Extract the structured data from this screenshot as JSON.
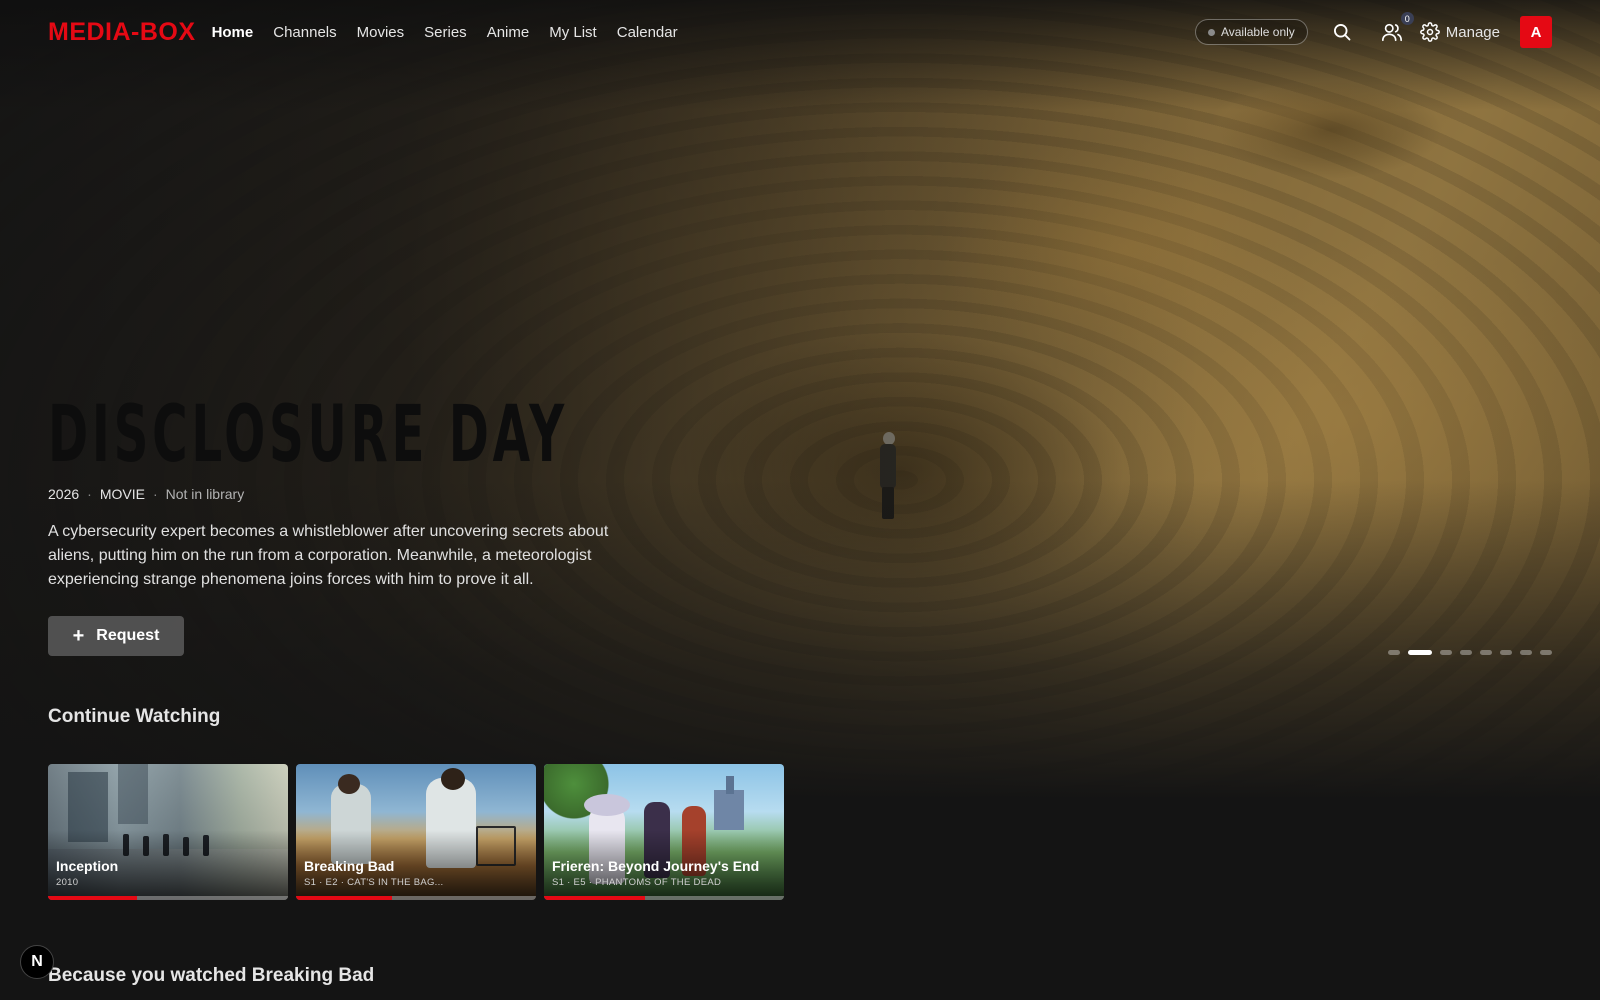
{
  "header": {
    "logo": "MEDIA-BOX",
    "nav": [
      "Home",
      "Channels",
      "Movies",
      "Series",
      "Anime",
      "My List",
      "Calendar"
    ],
    "active_nav": "Home",
    "availability_filter": "Available only",
    "requests_badge": "0",
    "manage_label": "Manage",
    "avatar_initial": "A",
    "accent_color": "#e50914"
  },
  "hero": {
    "title": "DISCLOSURE DAY",
    "year": "2026",
    "type": "MOVIE",
    "library_status": "Not in library",
    "description": "A cybersecurity expert becomes a whistleblower after uncovering secrets about aliens, putting him on the run from a corporation. Meanwhile, a meteorologist experiencing strange phenomena joins forces with him to prove it all.",
    "request_label": "Request",
    "carousel_count": 8,
    "carousel_active_index": 1
  },
  "continue_watching": {
    "title": "Continue Watching",
    "items": [
      {
        "title": "Inception",
        "subtitle": "2010",
        "progress": 0.37
      },
      {
        "title": "Breaking Bad",
        "subtitle": "S1 · E2 · CAT'S IN THE BAG...",
        "progress": 0.4
      },
      {
        "title": "Frieren: Beyond Journey's End",
        "subtitle": "S1 · E5 · PHANTOMS OF THE DEAD",
        "progress": 0.42
      }
    ]
  },
  "because_you_watched": {
    "title": "Because you watched Breaking Bad"
  },
  "dev_badge": "N"
}
